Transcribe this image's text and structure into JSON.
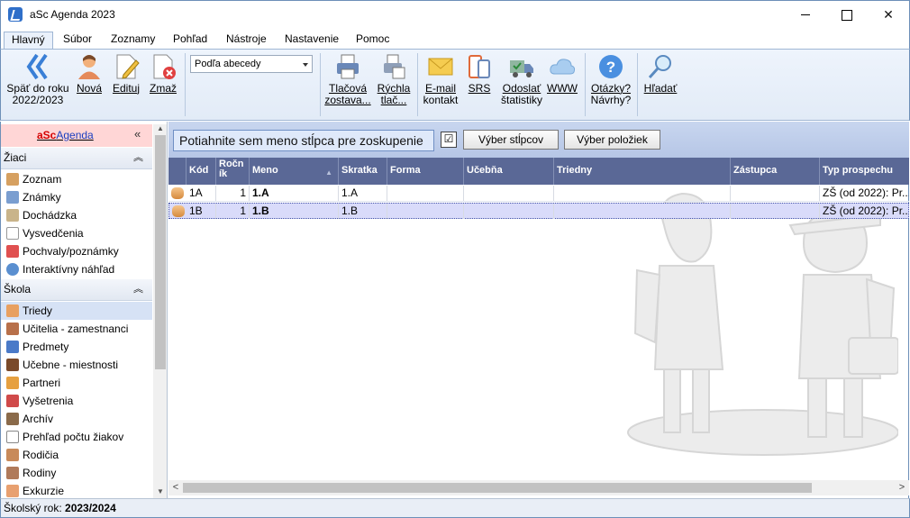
{
  "window": {
    "title": "aSc Agenda 2023"
  },
  "tabs": [
    {
      "label": "Hlavný",
      "active": true
    },
    {
      "label": "Súbor"
    },
    {
      "label": "Zoznamy"
    },
    {
      "label": "Pohľad"
    },
    {
      "label": "Nástroje"
    },
    {
      "label": "Nastavenie"
    },
    {
      "label": "Pomoc"
    }
  ],
  "ribbon": {
    "back": {
      "line1": "Späť do roku",
      "line2": "2022/2023",
      "icon": "double-chevron-left-icon"
    },
    "new": {
      "label": "Nová",
      "icon": "person-add-icon"
    },
    "edit": {
      "label": "Edituj",
      "icon": "document-edit-icon"
    },
    "delete": {
      "label": "Zmaž",
      "icon": "document-delete-icon"
    },
    "sort": {
      "value": "Podľa abecedy"
    },
    "print_set": {
      "line1": "Tlačová",
      "line2": "zostava..."
    },
    "quick_print": {
      "line1": "Rýchla",
      "line2": "tlač..."
    },
    "email": {
      "line1": "E-mail",
      "line2": "kontakt"
    },
    "srs": {
      "label": "SRS"
    },
    "send_stats": {
      "line1": "Odoslať",
      "line2": "štatistiky"
    },
    "www": {
      "label": "WWW"
    },
    "questions": {
      "line1": "Otázky?",
      "line2": "Návrhy?"
    },
    "search": {
      "label": "Hľadať"
    }
  },
  "sidebar": {
    "brand_red": "aSc",
    "brand_blue": "Agenda",
    "collapse_glyph": "«",
    "sections": [
      {
        "title": "Žiaci",
        "items": [
          "Zoznam",
          "Známky",
          "Dochádzka",
          "Vysvedčenia",
          "Pochvaly/poznámky",
          "Interaktívny náhľad"
        ]
      },
      {
        "title": "Škola",
        "items": [
          "Triedy",
          "Učitelia - zamestnanci",
          "Predmety",
          "Učebne - miestnosti",
          "Partneri",
          "Vyšetrenia",
          "Archív",
          "Prehľad počtu žiakov",
          "Rodičia",
          "Rodiny",
          "Exkurzie"
        ]
      }
    ],
    "selected": "Triedy"
  },
  "toolbar": {
    "group_placeholder": "Potiahnite sem meno stĺpca pre zoskupenie",
    "columns_button": "Výber stĺpcov",
    "items_button": "Výber položiek"
  },
  "grid": {
    "columns": [
      "Kód",
      "Ročník",
      "Meno",
      "Skratka",
      "Forma",
      "Učebňa",
      "Triedny",
      "Zástupca",
      "Typ prospechu"
    ],
    "rows": [
      {
        "kod": "1A",
        "rocnik": "1",
        "meno": "1.A",
        "skratka": "1.A",
        "forma": "",
        "ucebna": "",
        "triedny": "",
        "zastupca": "",
        "typ": "ZŠ (od 2022): Pr...",
        "selected": false
      },
      {
        "kod": "1B",
        "rocnik": "1",
        "meno": "1.B",
        "skratka": "1.B",
        "forma": "",
        "ucebna": "",
        "triedny": "",
        "zastupca": "",
        "typ": "ZŠ (od 2022): Pr...",
        "selected": true
      }
    ]
  },
  "status": {
    "label": "Školský rok:",
    "value": "2023/2024"
  }
}
